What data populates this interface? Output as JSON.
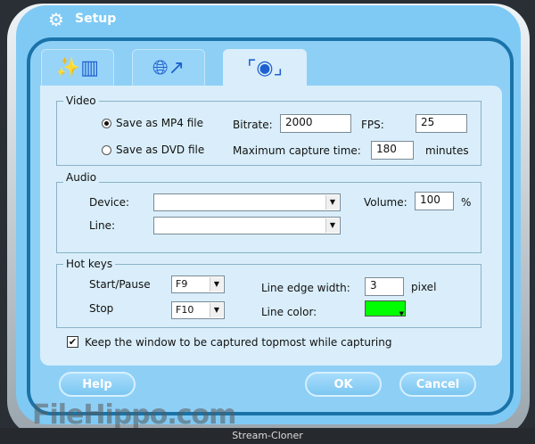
{
  "window": {
    "title": "Setup",
    "app_name": "Stream-Cloner",
    "watermark": "FileHippo.com"
  },
  "tabs": [
    {
      "icon": "magic-wand-files-icon"
    },
    {
      "icon": "globe-folder-icon"
    },
    {
      "icon": "eye-capture-icon",
      "active": true
    }
  ],
  "video": {
    "label": "Video",
    "mp4_label": "Save as MP4 file",
    "dvd_label": "Save as DVD file",
    "selected": "mp4",
    "bitrate_label": "Bitrate:",
    "bitrate": "2000",
    "fps_label": "FPS:",
    "fps": "25",
    "max_time_label": "Maximum capture time:",
    "max_time": "180",
    "minutes_label": "minutes"
  },
  "audio": {
    "label": "Audio",
    "device_label": "Device:",
    "device": "",
    "line_label": "Line:",
    "line": "",
    "volume_label": "Volume:",
    "volume": "100",
    "percent": "%"
  },
  "hotkeys": {
    "label": "Hot keys",
    "start_label": "Start/Pause",
    "start": "F9",
    "stop_label": "Stop",
    "stop": "F10",
    "edge_label": "Line edge width:",
    "edge": "3",
    "pixel_label": "pixel",
    "color_label": "Line color:",
    "color": "#00ff00"
  },
  "topmost": {
    "label": "Keep the window to be captured topmost while capturing",
    "checked": true
  },
  "buttons": {
    "help": "Help",
    "ok": "OK",
    "cancel": "Cancel"
  }
}
